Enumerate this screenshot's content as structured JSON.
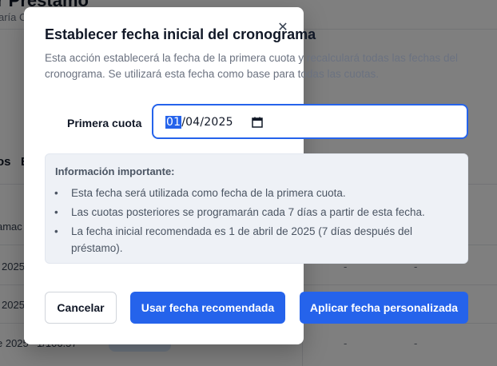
{
  "background": {
    "title_fragment": "r Préstamo",
    "subtitle_fragment": "aría C",
    "tab_fragments": [
      "os",
      "E"
    ],
    "column_fragment": "amac",
    "row_cells": [
      "2025",
      "2025",
      "e 2025",
      "1/106.57"
    ],
    "dash": "-"
  },
  "dialog": {
    "title": "Establecer fecha inicial del cronograma",
    "description": "Esta acción establecerá la fecha de la primera cuota y recalculará todas las fechas del cronograma. Se utilizará esta fecha como base para todas las cuotas.",
    "field": {
      "label": "Primera cuota",
      "value_day": "01",
      "value_rest": "/04/2025"
    },
    "info": {
      "title": "Información importante:",
      "items": [
        "Esta fecha será utilizada como fecha de la primera cuota.",
        "Las cuotas posteriores se programarán cada 7 días a partir de esta fecha.",
        "La fecha inicial recomendada es 1 de abril de 2025 (7 días después del préstamo)."
      ]
    },
    "buttons": {
      "cancel": "Cancelar",
      "recommended": "Usar fecha recomendada",
      "apply": "Aplicar fecha personalizada"
    },
    "close_icon": "close-icon"
  },
  "colors": {
    "primary": "#2563eb",
    "overlay": "rgba(0,0,0,0.5)"
  }
}
